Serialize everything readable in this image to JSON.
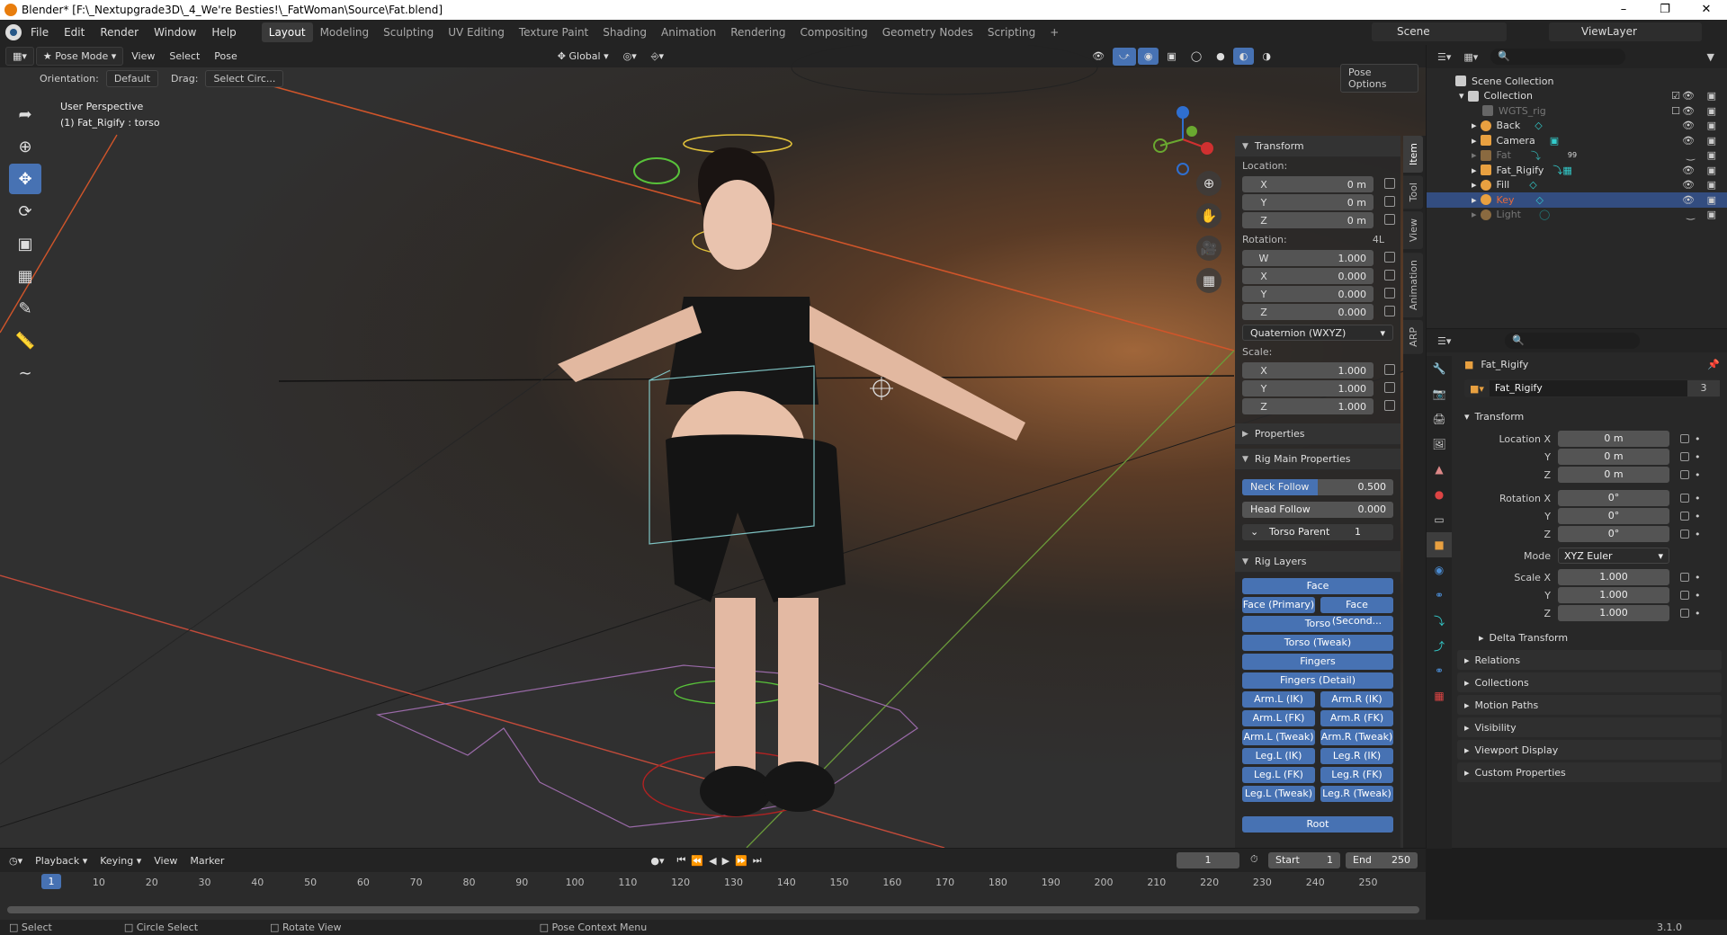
{
  "window": {
    "title": "Blender* [F:\\_Nextupgrade3D\\_4_We're Besties!\\_FatWoman\\Source\\Fat.blend]"
  },
  "menu": [
    "File",
    "Edit",
    "Render",
    "Window",
    "Help"
  ],
  "workspaces": [
    "Layout",
    "Modeling",
    "Sculpting",
    "UV Editing",
    "Texture Paint",
    "Shading",
    "Animation",
    "Rendering",
    "Compositing",
    "Geometry Nodes",
    "Scripting"
  ],
  "scene": "Scene",
  "view_layer": "ViewLayer",
  "viewport_header": {
    "mode": "Pose Mode",
    "view": "View",
    "select": "Select",
    "pose": "Pose",
    "transform_orientation": "Global"
  },
  "tool_settings": {
    "orientation_label": "Orientation:",
    "orientation_value": "Default",
    "drag_label": "Drag:",
    "drag_value": "Select Circ..."
  },
  "pose_options": "Pose Options",
  "viewport_info": {
    "line1": "User Perspective",
    "line2": "(1) Fat_Rigify : torso"
  },
  "npanel": {
    "tabs": [
      "Item",
      "Tool",
      "View",
      "Animation",
      "ARP"
    ],
    "transform": {
      "title": "Transform",
      "location_label": "Location:",
      "location": [
        {
          "k": "X",
          "v": "0 m"
        },
        {
          "k": "Y",
          "v": "0 m"
        },
        {
          "k": "Z",
          "v": "0 m"
        }
      ],
      "rotation_label": "Rotation:",
      "rotation_lock": "4L",
      "rotation": [
        {
          "k": "W",
          "v": "1.000"
        },
        {
          "k": "X",
          "v": "0.000"
        },
        {
          "k": "Y",
          "v": "0.000"
        },
        {
          "k": "Z",
          "v": "0.000"
        }
      ],
      "rotation_mode": "Quaternion (WXYZ)",
      "scale_label": "Scale:",
      "scale": [
        {
          "k": "X",
          "v": "1.000"
        },
        {
          "k": "Y",
          "v": "1.000"
        },
        {
          "k": "Z",
          "v": "1.000"
        }
      ]
    },
    "properties_title": "Properties",
    "rig_main": {
      "title": "Rig Main Properties",
      "neck_follow_label": "Neck Follow",
      "neck_follow": 0.5,
      "neck_follow_text": "0.500",
      "head_follow_label": "Head Follow",
      "head_follow": 0.0,
      "head_follow_text": "0.000",
      "torso_parent_label": "Torso Parent",
      "torso_parent_value": "1"
    },
    "rig_layers": {
      "title": "Rig Layers",
      "face": "Face",
      "face_primary": "Face (Primary)",
      "face_secondary": "Face (Second...",
      "torso": "Torso",
      "torso_tweak": "Torso (Tweak)",
      "fingers": "Fingers",
      "fingers_detail": "Fingers (Detail)",
      "pairs": [
        [
          "Arm.L (IK)",
          "Arm.R (IK)"
        ],
        [
          "Arm.L (FK)",
          "Arm.R (FK)"
        ],
        [
          "Arm.L (Tweak)",
          "Arm.R (Tweak)"
        ],
        [
          "Leg.L (IK)",
          "Leg.R (IK)"
        ],
        [
          "Leg.L (FK)",
          "Leg.R (FK)"
        ],
        [
          "Leg.L (Tweak)",
          "Leg.R (Tweak)"
        ]
      ],
      "root": "Root"
    }
  },
  "outliner": {
    "scene_collection": "Scene Collection",
    "collection": "Collection",
    "items": [
      "WGTS_rig",
      "Back",
      "Camera",
      "Fat",
      "Fat_Rigify",
      "Fill",
      "Key",
      "Light"
    ],
    "fat_badge": "99"
  },
  "properties": {
    "object_name": "Fat_Rigify",
    "data_name": "Fat_Rigify",
    "users": "3",
    "transform_title": "Transform",
    "location": [
      {
        "k": "Location X",
        "v": "0 m"
      },
      {
        "k": "Y",
        "v": "0 m"
      },
      {
        "k": "Z",
        "v": "0 m"
      }
    ],
    "rotation": [
      {
        "k": "Rotation X",
        "v": "0°"
      },
      {
        "k": "Y",
        "v": "0°"
      },
      {
        "k": "Z",
        "v": "0°"
      }
    ],
    "mode_label": "Mode",
    "mode_value": "XYZ Euler",
    "scale": [
      {
        "k": "Scale X",
        "v": "1.000"
      },
      {
        "k": "Y",
        "v": "1.000"
      },
      {
        "k": "Z",
        "v": "1.000"
      }
    ],
    "delta": "Delta Transform",
    "sections": [
      "Relations",
      "Collections",
      "Motion Paths",
      "Visibility",
      "Viewport Display",
      "Custom Properties"
    ]
  },
  "timeline": {
    "menus": [
      "Playback",
      "Keying",
      "View",
      "Marker"
    ],
    "current_frame": "1",
    "start_label": "Start",
    "start": "1",
    "end_label": "End",
    "end": "250",
    "ticks": [
      "10",
      "20",
      "30",
      "40",
      "50",
      "60",
      "70",
      "80",
      "90",
      "100",
      "110",
      "120",
      "130",
      "140",
      "150",
      "160",
      "170",
      "180",
      "190",
      "200",
      "210",
      "220",
      "230",
      "240",
      "250"
    ],
    "cursor": "1"
  },
  "statusbar": {
    "select": "Select",
    "circle_select": "Circle Select",
    "rotate_view": "Rotate View",
    "context_menu": "Pose Context Menu",
    "version": "3.1.0"
  }
}
